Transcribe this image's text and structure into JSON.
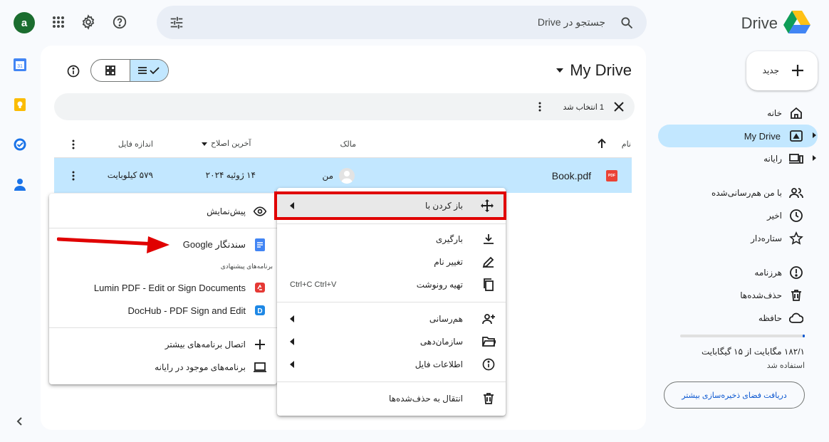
{
  "header": {
    "avatar_letter": "a",
    "search_placeholder": "جستجو در Drive",
    "logo_text": "Drive"
  },
  "main": {
    "title": "My Drive",
    "selection": "1 انتخاب شد",
    "columns": {
      "name": "نام",
      "owner": "مالک",
      "modified": "آخرین اصلاح",
      "size": "اندازه فایل"
    },
    "rows": [
      {
        "name": "Book.pdf",
        "type_badge": "PDF",
        "owner": "من",
        "modified": "۱۴ ژوئیه ۲۰۲۴",
        "size": "۵۷۹ کیلوبایت"
      }
    ]
  },
  "context_menu": {
    "open_with": "باز کردن با",
    "download": "بارگیری",
    "rename": "تغییر نام",
    "copy": "تهیه رونوشت",
    "copy_shortcut": "Ctrl+C Ctrl+V",
    "share": "هم‌رسانی",
    "organize": "سازمان‌دهی",
    "file_info": "اطلاعات فایل",
    "trash": "انتقال به حذف‌شده‌ها"
  },
  "submenu": {
    "preview": "پیش‌نمایش",
    "google_docs": "سندنگار Google",
    "suggested_header": "برنامه‌های پیشنهادی",
    "lumin": "Lumin PDF - Edit or Sign Documents",
    "dochub": "DocHub - PDF Sign and Edit",
    "connect_more": "اتصال برنامه‌های بیشتر",
    "computer_apps": "برنامه‌های موجود در رایانه"
  },
  "sidebar": {
    "new_label": "جدید",
    "items": [
      {
        "label": "خانه"
      },
      {
        "label": "My Drive"
      },
      {
        "label": "رایانه"
      },
      {
        "label": "با من هم‌رسانی‌شده"
      },
      {
        "label": "اخیر"
      },
      {
        "label": "ستاره‌دار"
      },
      {
        "label": "هرزنامه"
      },
      {
        "label": "حذف‌شده‌ها"
      },
      {
        "label": "حافظه"
      }
    ],
    "storage_used": "۱۸۲/۱ مگابایت از ۱۵ گیگابایت",
    "storage_used_label": "استفاده شد",
    "storage_fraction": 0.012,
    "get_storage": "دریافت فضای ذخیره‌سازی بیشتر"
  },
  "colors": {
    "accent": "#0b57d0",
    "selected": "#c2e7ff",
    "highlight_border": "#e00000",
    "arrow": "#e00000"
  }
}
